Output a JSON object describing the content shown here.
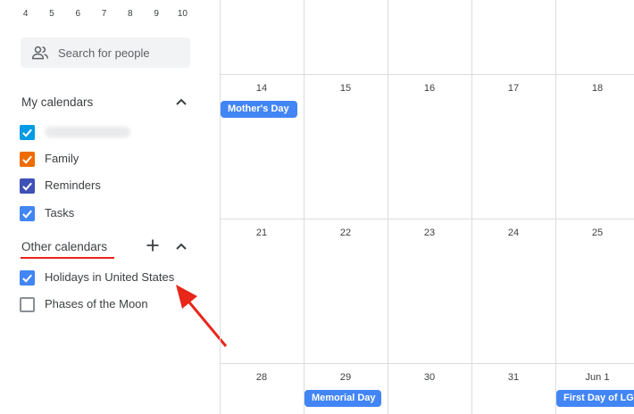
{
  "mini_calendar": {
    "days": [
      "4",
      "5",
      "6",
      "7",
      "8",
      "9",
      "10"
    ]
  },
  "search": {
    "placeholder": "Search for people"
  },
  "my_calendars": {
    "title": "My calendars",
    "items": [
      {
        "label": "",
        "color": "#039be5",
        "checked": true
      },
      {
        "label": "Family",
        "color": "#ef6c00",
        "checked": true
      },
      {
        "label": "Reminders",
        "color": "#3f51b5",
        "checked": true
      },
      {
        "label": "Tasks",
        "color": "#4285f4",
        "checked": true
      }
    ]
  },
  "other_calendars": {
    "title": "Other calendars",
    "items": [
      {
        "label": "Holidays in United States",
        "color": "#4285f4",
        "checked": true
      },
      {
        "label": "Phases of the Moon",
        "color": "#8a8f94",
        "checked": false
      }
    ]
  },
  "month_grid": {
    "weeks": [
      {
        "days": [
          "14",
          "15",
          "16",
          "17",
          "18"
        ]
      },
      {
        "days": [
          "21",
          "22",
          "23",
          "24",
          "25"
        ]
      },
      {
        "days": [
          "28",
          "29",
          "30",
          "31",
          "Jun 1"
        ]
      }
    ],
    "events": [
      {
        "label": "Mother's Day"
      },
      {
        "label": "Memorial Day"
      },
      {
        "label": "First Day of LGBTQ+ Pride Month"
      }
    ]
  },
  "colors": {
    "accent": "#4285f4",
    "annotation": "#e8261a"
  }
}
